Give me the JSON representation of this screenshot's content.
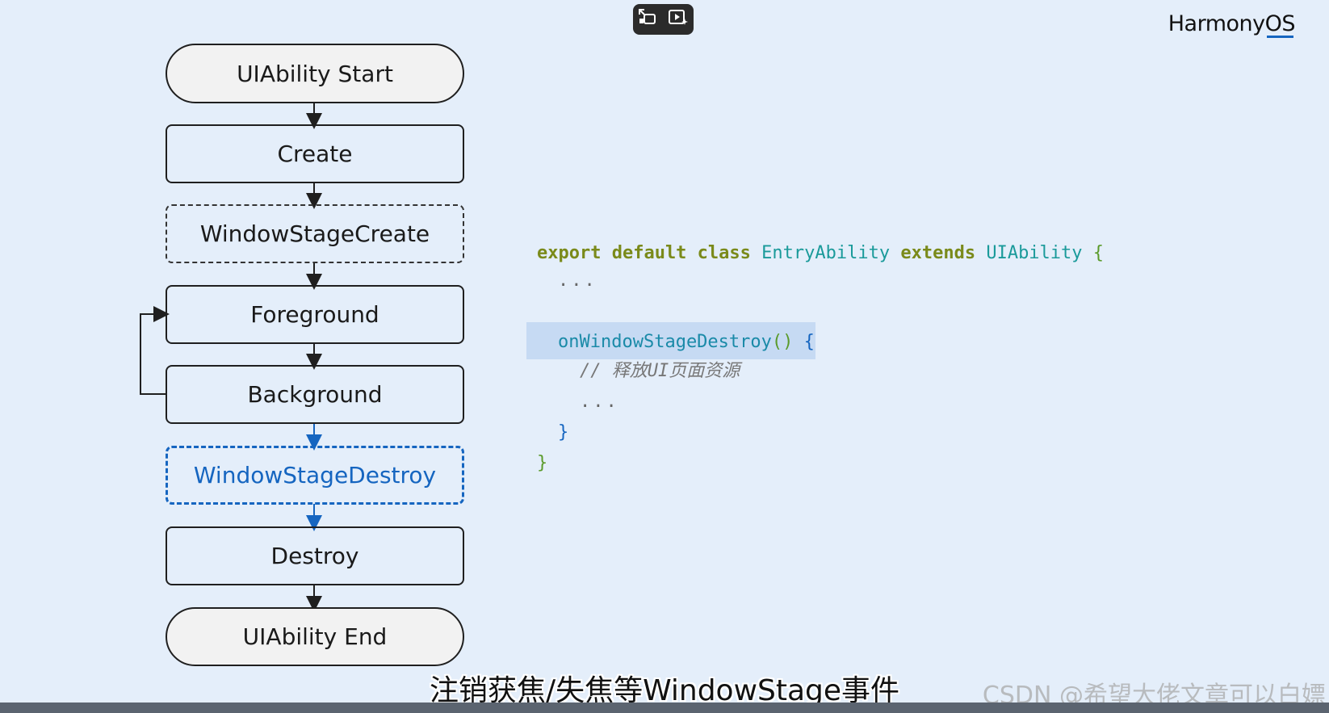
{
  "brand": {
    "text_prefix": "Harmony",
    "text_suffix": "OS"
  },
  "toolbar": {
    "icons": [
      "screen-shrink-icon",
      "video-sparkle-icon"
    ]
  },
  "flowchart": {
    "nodes": [
      {
        "id": "start",
        "label": "UIAbility Start",
        "style": "pill"
      },
      {
        "id": "create",
        "label": "Create",
        "style": "solid"
      },
      {
        "id": "wsc",
        "label": "WindowStageCreate",
        "style": "dashed"
      },
      {
        "id": "fg",
        "label": "Foreground",
        "style": "solid"
      },
      {
        "id": "bg",
        "label": "Background",
        "style": "solid"
      },
      {
        "id": "wsd",
        "label": "WindowStageDestroy",
        "style": "dashed-blue"
      },
      {
        "id": "destroy",
        "label": "Destroy",
        "style": "solid"
      },
      {
        "id": "end",
        "label": "UIAbility End",
        "style": "pill"
      }
    ],
    "highlight_color": "#1565c0"
  },
  "code": {
    "l1_kw1": "export default class",
    "l1_cls": "EntryAbility",
    "l1_kw2": "extends",
    "l1_base": "UIAbility",
    "l1_brace": "{",
    "l2": "...",
    "l4_fn": "onWindowStageDestroy",
    "l4_parens": "()",
    "l4_brace": "{",
    "l5": "// 释放UI页面资源",
    "l6": "...",
    "l7": "}",
    "l8": "}"
  },
  "subtitle": "注销获焦/失焦等WindowStage事件",
  "watermark": "CSDN @希望大佬文章可以白嫖"
}
